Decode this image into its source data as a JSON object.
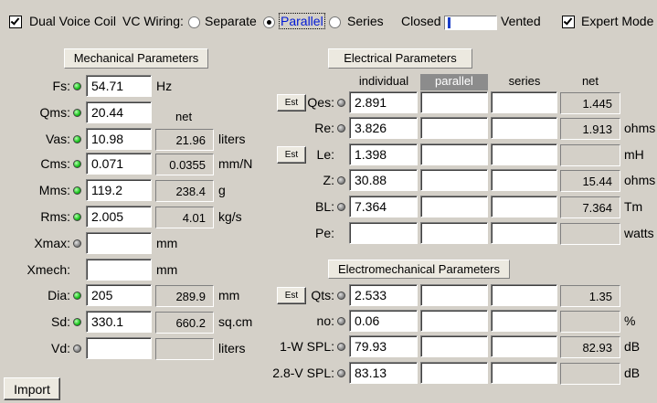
{
  "toolbar": {
    "dual_voice_coil": {
      "label": "Dual Voice Coil",
      "checked": true
    },
    "vc_wiring_label": "VC Wiring:",
    "wiring_options": [
      {
        "label": "Separate",
        "selected": false
      },
      {
        "label": "Parallel",
        "selected": true
      },
      {
        "label": "Series",
        "selected": false
      }
    ],
    "closed_label": "Closed",
    "vented_label": "Vented",
    "enclosure_position": 0.05,
    "expert_mode": {
      "label": "Expert Mode",
      "checked": true
    }
  },
  "mechanical": {
    "title": "Mechanical Parameters",
    "net_header": "net",
    "rows": [
      {
        "label": "Fs:",
        "led": "green",
        "value": "54.71",
        "net": null,
        "unit": "Hz"
      },
      {
        "label": "Qms:",
        "led": "green",
        "value": "20.44",
        "net": null,
        "unit": ""
      },
      {
        "label": "Vas:",
        "led": "green",
        "value": "10.98",
        "net": "21.96",
        "unit": "liters"
      },
      {
        "label": "Cms:",
        "led": "green",
        "value": "0.071",
        "net": "0.0355",
        "unit": "mm/N"
      },
      {
        "label": "Mms:",
        "led": "green",
        "value": "119.2",
        "net": "238.4",
        "unit": "g"
      },
      {
        "label": "Rms:",
        "led": "green",
        "value": "2.005",
        "net": "4.01",
        "unit": "kg/s"
      },
      {
        "label": "Xmax:",
        "led": "gray",
        "value": "",
        "net": null,
        "unit": "mm"
      },
      {
        "label": "Xmech:",
        "led": null,
        "value": "",
        "net": null,
        "unit": "mm"
      },
      {
        "label": "Dia:",
        "led": "green",
        "value": "205",
        "net": "289.9",
        "unit": "mm"
      },
      {
        "label": "Sd:",
        "led": "green",
        "value": "330.1",
        "net": "660.2",
        "unit": "sq.cm"
      },
      {
        "label": "Vd:",
        "led": "gray",
        "value": "",
        "net": "",
        "unit": "liters"
      }
    ]
  },
  "electrical": {
    "title": "Electrical Parameters",
    "columns": [
      "individual",
      "parallel",
      "series",
      "net"
    ],
    "active_column": 1,
    "est_label": "Est",
    "rows": [
      {
        "label": "Qes:",
        "led": "gray",
        "est": true,
        "individual": "2.891",
        "parallel": "",
        "series": "",
        "net": "1.445",
        "unit": ""
      },
      {
        "label": "Re:",
        "led": "gray",
        "est": false,
        "individual": "3.826",
        "parallel": "",
        "series": "",
        "net": "1.913",
        "unit": "ohms"
      },
      {
        "label": "Le:",
        "led": null,
        "est": true,
        "individual": "1.398",
        "parallel": "",
        "series": "",
        "net": "",
        "unit": "mH"
      },
      {
        "label": "Z:",
        "led": "gray",
        "est": false,
        "individual": "30.88",
        "parallel": "",
        "series": "",
        "net": "15.44",
        "unit": "ohms"
      },
      {
        "label": "BL:",
        "led": "gray",
        "est": false,
        "individual": "7.364",
        "parallel": "",
        "series": "",
        "net": "7.364",
        "unit": "Tm"
      },
      {
        "label": "Pe:",
        "led": null,
        "est": false,
        "individual": "",
        "parallel": "",
        "series": "",
        "net": "",
        "unit": "watts"
      }
    ]
  },
  "electromechanical": {
    "title": "Electromechanical Parameters",
    "rows": [
      {
        "label": "Qts:",
        "led": "gray",
        "est": true,
        "individual": "2.533",
        "parallel": "",
        "series": "",
        "net": "1.35",
        "unit": ""
      },
      {
        "label": "no:",
        "led": "gray",
        "est": false,
        "individual": "0.06",
        "parallel": "",
        "series": "",
        "net": "",
        "unit": "%"
      },
      {
        "label": "1-W SPL:",
        "led": "gray",
        "est": false,
        "individual": "79.93",
        "parallel": "",
        "series": "",
        "net": "82.93",
        "unit": "dB"
      },
      {
        "label": "2.8-V SPL:",
        "led": "gray",
        "est": false,
        "individual": "83.13",
        "parallel": "",
        "series": "",
        "net": "",
        "unit": "dB"
      }
    ]
  },
  "import_label": "Import"
}
